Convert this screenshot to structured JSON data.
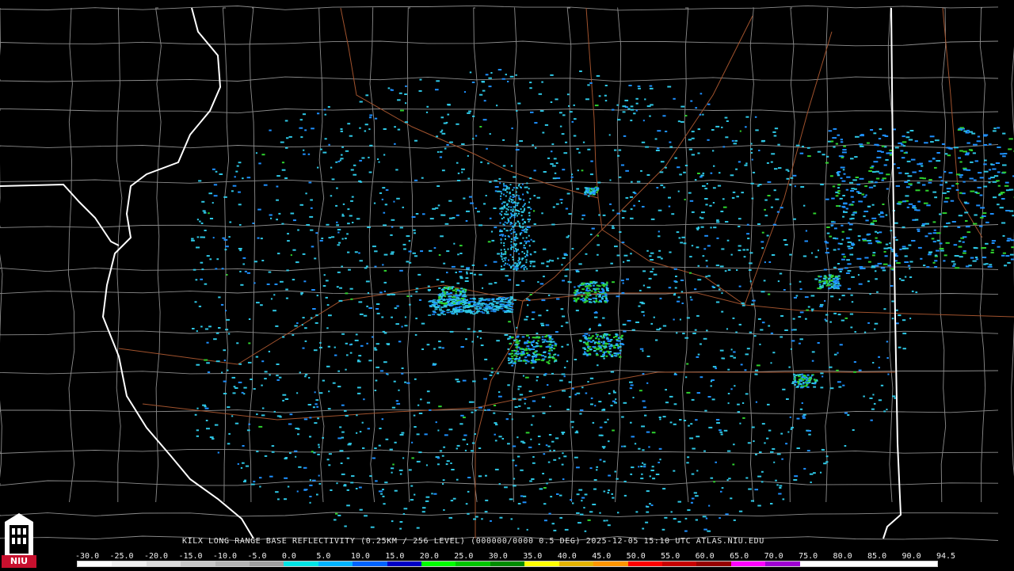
{
  "header": {
    "title": "KILX LONG RANGE BASE REFLECTIVITY (0.25KM / 256 LEVEL) (000000/0000 0.5 DEG) 2025-12-05 15:10 UTC  ATLAS.NIU.EDU"
  },
  "scale": {
    "labels": [
      "-30.0",
      "-25.0",
      "-20.0",
      "-15.0",
      "-10.0",
      "-5.0",
      "0.0",
      "5.0",
      "10.0",
      "15.0",
      "20.0",
      "25.0",
      "30.0",
      "35.0",
      "40.0",
      "45.0",
      "50.0",
      "55.0",
      "60.0",
      "65.0",
      "70.0",
      "75.0",
      "80.0",
      "85.0",
      "90.0",
      "94.5"
    ],
    "colors": [
      "#ffffff",
      "#f0f0f0",
      "#dcdcdc",
      "#c8c8c8",
      "#b4b4b4",
      "#a0a0a0",
      "#00e6e6",
      "#00b4ff",
      "#0064ff",
      "#0000c8",
      "#00ff00",
      "#00c800",
      "#008c00",
      "#ffff00",
      "#e6b400",
      "#ff9600",
      "#ff0000",
      "#c80000",
      "#960000",
      "#ff00ff",
      "#a000d2",
      "#ffffff",
      "#ffffff",
      "#ffffff",
      "#ffffff"
    ]
  },
  "logo": {
    "text": "NIU"
  },
  "colors": {
    "background": "#000000",
    "county_line": "#8c8c8c",
    "state_line": "#ffffff",
    "road": "#a0522d",
    "echo_light": "#2ec8e6",
    "echo_mid": "#1e90ff",
    "echo_heavy": "#2ed22e"
  }
}
